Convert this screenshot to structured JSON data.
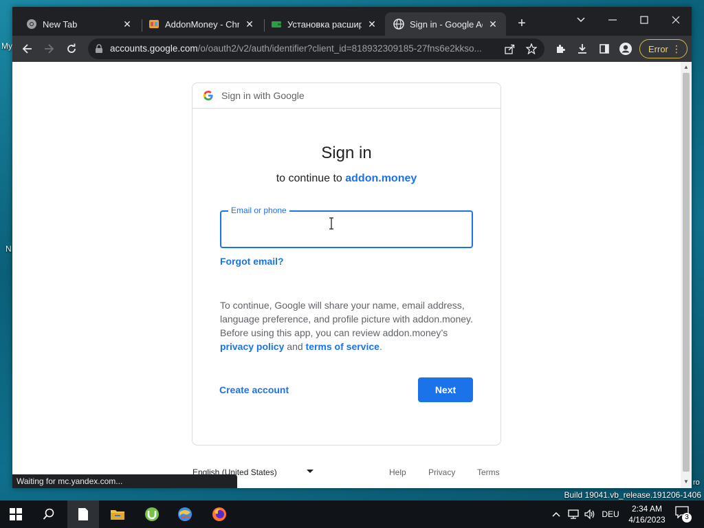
{
  "desktop": {
    "labels": [
      "My",
      "N",
      "ro"
    ]
  },
  "browser": {
    "tabs": [
      {
        "title": "New Tab",
        "icon": "chrome-icon"
      },
      {
        "title": "AddonMoney - Chrom",
        "icon": "addonmoney-icon"
      },
      {
        "title": "Установка расширения",
        "icon": "wallet-icon"
      },
      {
        "title": "Sign in - Google Accounts",
        "icon": "globe-icon",
        "active": true
      }
    ],
    "address": {
      "host": "accounts.google.com",
      "path": "/o/oauth2/v2/auth/identifier?client_id=818932309185-27fns6e2kkso..."
    },
    "error_label": "Error",
    "status_text": "Waiting for mc.yandex.com..."
  },
  "signin": {
    "header": "Sign in with Google",
    "title": "Sign in",
    "continue_prefix": "to continue to ",
    "app_name": "addon.money",
    "email_label": "Email or phone",
    "email_value": "",
    "forgot_email": "Forgot email?",
    "consent_text": "To continue, Google will share your name, email address, language preference, and profile picture with addon.money. Before using this app, you can review addon.money’s ",
    "privacy_policy": "privacy policy",
    "and": " and ",
    "terms_of_service": "terms of service",
    "period": ".",
    "create_account": "Create account",
    "next": "Next"
  },
  "footer": {
    "language": "English (United States)",
    "help": "Help",
    "privacy": "Privacy",
    "terms": "Terms"
  },
  "system": {
    "build": "Build 19041.vb_release.191206-1406",
    "language": "DEU",
    "time": "2:34 AM",
    "date": "4/16/2023",
    "notification_count": "3"
  },
  "colors": {
    "accent": "#1a73e8",
    "error_pill": "#f3d36b"
  }
}
